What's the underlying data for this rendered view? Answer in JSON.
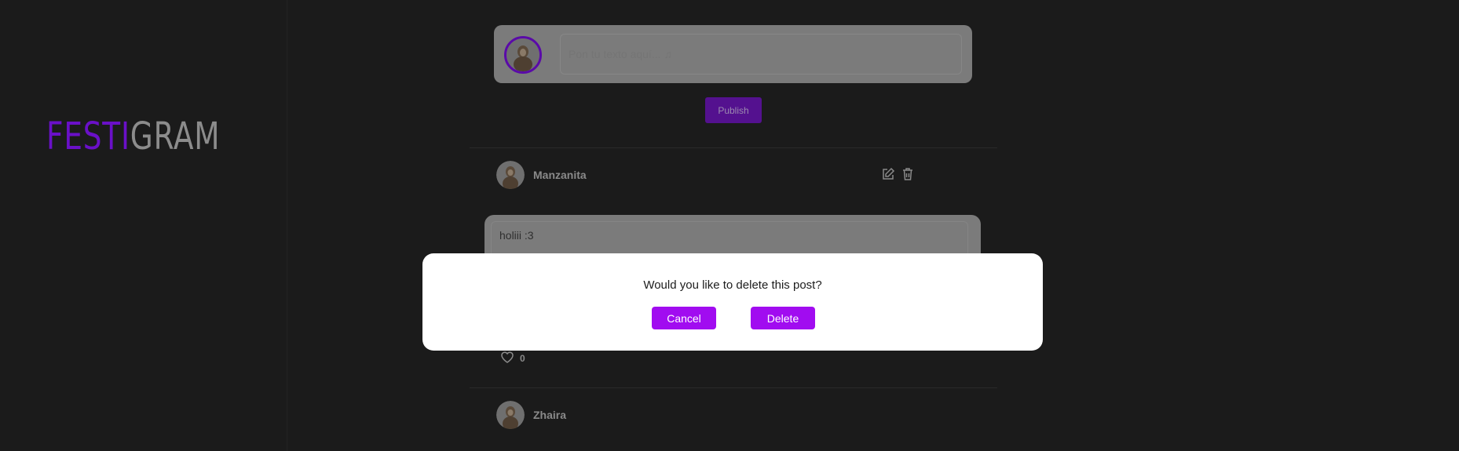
{
  "brand": {
    "logo_part1": "FESTI",
    "logo_part2": "GRAM"
  },
  "composer": {
    "placeholder": "Pon tu texto aquí... ♫",
    "publish_label": "Publish"
  },
  "posts": [
    {
      "username": "Manzanita",
      "text": "holiii :3",
      "likes": "0"
    },
    {
      "username": "Zhaira"
    }
  ],
  "modal": {
    "question": "Would you like to delete this post?",
    "cancel_label": "Cancel",
    "delete_label": "Delete"
  },
  "colors": {
    "accent": "#a10cf0",
    "logo_purple": "#6a10c8",
    "background": "#1b1b1b"
  }
}
